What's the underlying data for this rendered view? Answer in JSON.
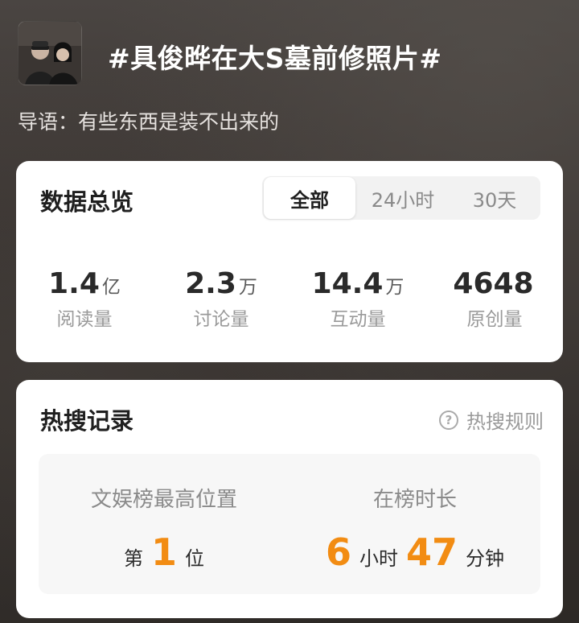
{
  "header": {
    "topic_title": "#具俊晔在大S墓前修照片#",
    "lead_text": "导语：有些东西是装不出来的"
  },
  "overview": {
    "title": "数据总览",
    "tabs": [
      "全部",
      "24小时",
      "30天"
    ],
    "active_tab": "全部",
    "stats": [
      {
        "value": "1.4",
        "unit": "亿",
        "label": "阅读量"
      },
      {
        "value": "2.3",
        "unit": "万",
        "label": "讨论量"
      },
      {
        "value": "14.4",
        "unit": "万",
        "label": "互动量"
      },
      {
        "value": "4648",
        "unit": "",
        "label": "原创量"
      }
    ]
  },
  "hot_search": {
    "title": "热搜记录",
    "rules_link": "热搜规则",
    "highest_position": {
      "label": "文娱榜最高位置",
      "prefix": "第",
      "value": "1",
      "suffix": "位"
    },
    "duration": {
      "label": "在榜时长",
      "hours": "6",
      "hours_unit": "小时",
      "minutes": "47",
      "minutes_unit": "分钟"
    }
  },
  "colors": {
    "accent": "#f28c13",
    "card_bg": "#ffffff",
    "record_bg": "#f7f7f7"
  }
}
